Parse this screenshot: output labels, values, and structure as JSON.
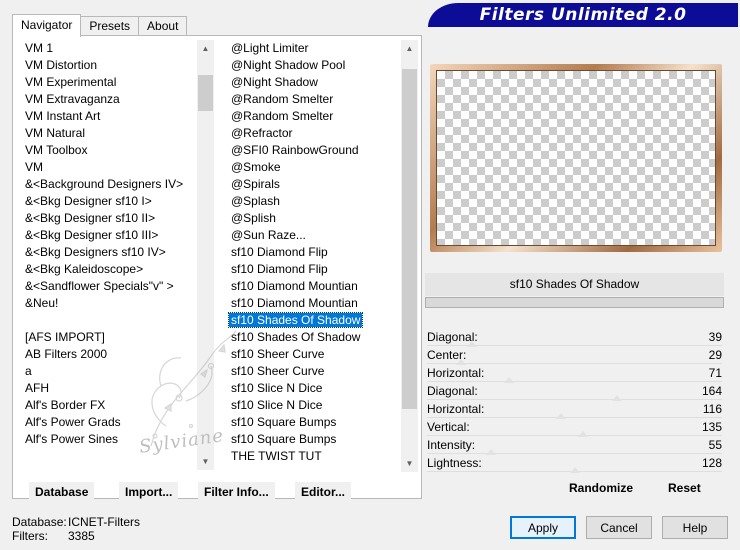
{
  "tabs": [
    {
      "label": "Navigator",
      "active": true
    },
    {
      "label": "Presets",
      "active": false
    },
    {
      "label": "About",
      "active": false
    }
  ],
  "banner": {
    "title": "Filters Unlimited 2.0"
  },
  "categories": [
    {
      "label": "VM 1",
      "selected": false
    },
    {
      "label": "VM Distortion",
      "selected": false
    },
    {
      "label": "VM Experimental",
      "selected": false
    },
    {
      "label": "VM Extravaganza",
      "selected": false
    },
    {
      "label": "VM Instant Art",
      "selected": false
    },
    {
      "label": "VM Natural",
      "selected": false
    },
    {
      "label": "VM Toolbox",
      "selected": false
    },
    {
      "label": "VM",
      "selected": false
    },
    {
      "label": "&<Background Designers IV>",
      "selected": false
    },
    {
      "label": "&<Bkg Designer sf10 I>",
      "selected": false
    },
    {
      "label": "&<Bkg Designer sf10 II>",
      "selected": false
    },
    {
      "label": "&<Bkg Designer sf10 III>",
      "selected": false
    },
    {
      "label": "&<Bkg Designers sf10 IV>",
      "selected": false
    },
    {
      "label": "&<Bkg Kaleidoscope>",
      "selected": false
    },
    {
      "label": "&<Sandflower Specials\"v\" >",
      "selected": false
    },
    {
      "label": "&Neu!",
      "selected": false
    },
    {
      "label": "",
      "selected": false
    },
    {
      "label": "[AFS IMPORT]",
      "selected": false
    },
    {
      "label": "AB Filters 2000",
      "selected": false
    },
    {
      "label": "a",
      "selected": false
    },
    {
      "label": "AFH",
      "selected": false
    },
    {
      "label": "Alf's Border FX",
      "selected": false
    },
    {
      "label": "Alf's Power Grads",
      "selected": false
    },
    {
      "label": "Alf's Power Sines",
      "selected": false
    }
  ],
  "filters": [
    {
      "label": "@Light Limiter",
      "selected": false
    },
    {
      "label": "@Night Shadow Pool",
      "selected": false
    },
    {
      "label": "@Night Shadow",
      "selected": false
    },
    {
      "label": "@Random Smelter",
      "selected": false
    },
    {
      "label": "@Random Smelter",
      "selected": false
    },
    {
      "label": "@Refractor",
      "selected": false
    },
    {
      "label": "@SFI0 RainbowGround",
      "selected": false
    },
    {
      "label": "@Smoke",
      "selected": false
    },
    {
      "label": "@Spirals",
      "selected": false
    },
    {
      "label": "@Splash",
      "selected": false
    },
    {
      "label": "@Splish",
      "selected": false
    },
    {
      "label": "@Sun Raze...",
      "selected": false
    },
    {
      "label": "sf10 Diamond Flip",
      "selected": false
    },
    {
      "label": "sf10 Diamond Flip",
      "selected": false
    },
    {
      "label": "sf10 Diamond Mountian",
      "selected": false
    },
    {
      "label": "sf10 Diamond Mountian",
      "selected": false
    },
    {
      "label": "sf10 Shades Of Shadow",
      "selected": true
    },
    {
      "label": "sf10 Shades Of Shadow",
      "selected": false
    },
    {
      "label": "sf10 Sheer Curve",
      "selected": false
    },
    {
      "label": "sf10 Sheer Curve",
      "selected": false
    },
    {
      "label": "sf10 Slice N Dice",
      "selected": false
    },
    {
      "label": "sf10 Slice N Dice",
      "selected": false
    },
    {
      "label": "sf10 Square Bumps",
      "selected": false
    },
    {
      "label": "sf10 Square Bumps",
      "selected": false
    },
    {
      "label": "THE TWIST TUT",
      "selected": false
    }
  ],
  "scroll": {
    "categories_position": 0.05,
    "filters_position": 0.2
  },
  "watermark": {
    "text": "Sylviane"
  },
  "left_buttons": {
    "database": "Database",
    "import": "Import...",
    "filter_info": "Filter Info...",
    "editor": "Editor..."
  },
  "filter_title": "sf10 Shades Of Shadow",
  "params": [
    {
      "label": "Diagonal:",
      "value": "39",
      "fraction": 0.153
    },
    {
      "label": "Center:",
      "value": "29",
      "fraction": 0.114
    },
    {
      "label": "Horizontal:",
      "value": "71",
      "fraction": 0.278
    },
    {
      "label": "Diagonal:",
      "value": "164",
      "fraction": 0.643
    },
    {
      "label": "Horizontal:",
      "value": "116",
      "fraction": 0.455
    },
    {
      "label": "Vertical:",
      "value": "135",
      "fraction": 0.529
    },
    {
      "label": "Intensity:",
      "value": "55",
      "fraction": 0.216
    },
    {
      "label": "Lightness:",
      "value": "128",
      "fraction": 0.502
    }
  ],
  "right_buttons": {
    "randomize": "Randomize",
    "reset": "Reset"
  },
  "status": {
    "database_label": "Database:",
    "database_value": "ICNET-Filters",
    "filters_label": "Filters:",
    "filters_value": "3385"
  },
  "dialog_buttons": {
    "apply": "Apply",
    "cancel": "Cancel",
    "help": "Help"
  }
}
